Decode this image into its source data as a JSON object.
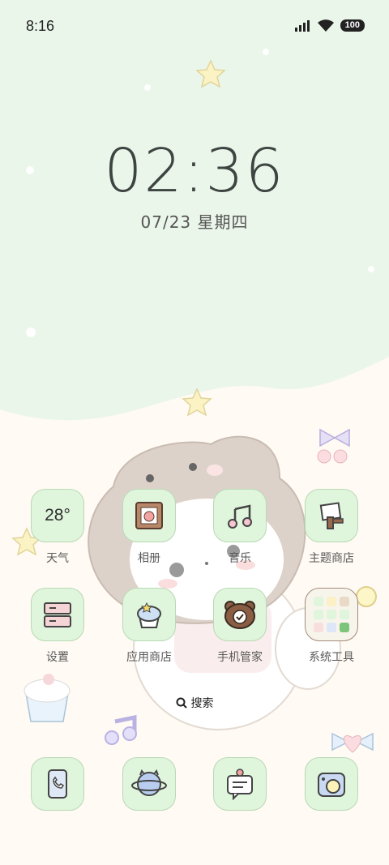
{
  "status_bar": {
    "time": "8:16",
    "battery": "100"
  },
  "lockscreen": {
    "clock": "02:36",
    "date": "07/23 星期四"
  },
  "apps": [
    {
      "label": "天气",
      "icon": "weather-widget",
      "value": "28°"
    },
    {
      "label": "相册",
      "icon": "photo-frame-icon"
    },
    {
      "label": "音乐",
      "icon": "music-note-icon"
    },
    {
      "label": "主题商店",
      "icon": "paint-brush-icon"
    },
    {
      "label": "设置",
      "icon": "drawer-icon"
    },
    {
      "label": "应用商店",
      "icon": "cupcake-icon"
    },
    {
      "label": "手机管家",
      "icon": "bear-shield-icon"
    },
    {
      "label": "系统工具",
      "icon": "folder-grid-icon"
    }
  ],
  "search": {
    "label": "搜索"
  },
  "dock": [
    {
      "icon": "phone-icon"
    },
    {
      "icon": "planet-icon"
    },
    {
      "icon": "message-icon"
    },
    {
      "icon": "camera-icon"
    }
  ],
  "colors": {
    "tile_bg": "#dff5dc",
    "tile_border": "#b9d9b5",
    "top_bg": "#ebf6ea",
    "bottom_bg": "#fffaf3"
  }
}
